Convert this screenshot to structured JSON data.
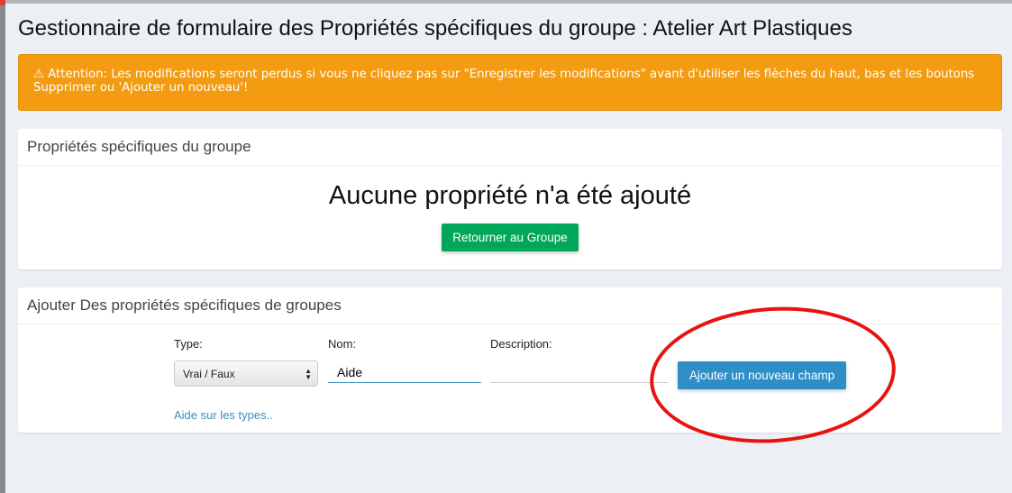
{
  "page_title": "Gestionnaire de formulaire des Propriétés spécifiques du groupe : Atelier Art Plastiques",
  "alert": {
    "icon": "warning-icon",
    "icon_glyph": "⚠",
    "text": "Attention: Les modifications seront perdus si vous ne cliquez pas sur \"Enregistrer les modifications\" avant d'utiliser les flèches du haut, bas et les boutons Supprimer ou 'Ajouter un nouveau'!"
  },
  "properties_box": {
    "title": "Propriétés spécifiques du groupe",
    "empty_message": "Aucune propriété n'a été ajouté",
    "return_button": "Retourner au Groupe"
  },
  "add_box": {
    "title": "Ajouter Des propriétés spécifiques de groupes",
    "type_label": "Type:",
    "type_value": "Vrai / Faux",
    "name_label": "Nom:",
    "name_value": "Aide",
    "description_label": "Description:",
    "description_value": "",
    "help_link": "Aide sur les types..",
    "add_button": "Ajouter un nouveau champ"
  },
  "colors": {
    "alert": "#f39c12",
    "green": "#00a65a",
    "blue": "#2e8fc7",
    "annotation": "#e8130f"
  }
}
